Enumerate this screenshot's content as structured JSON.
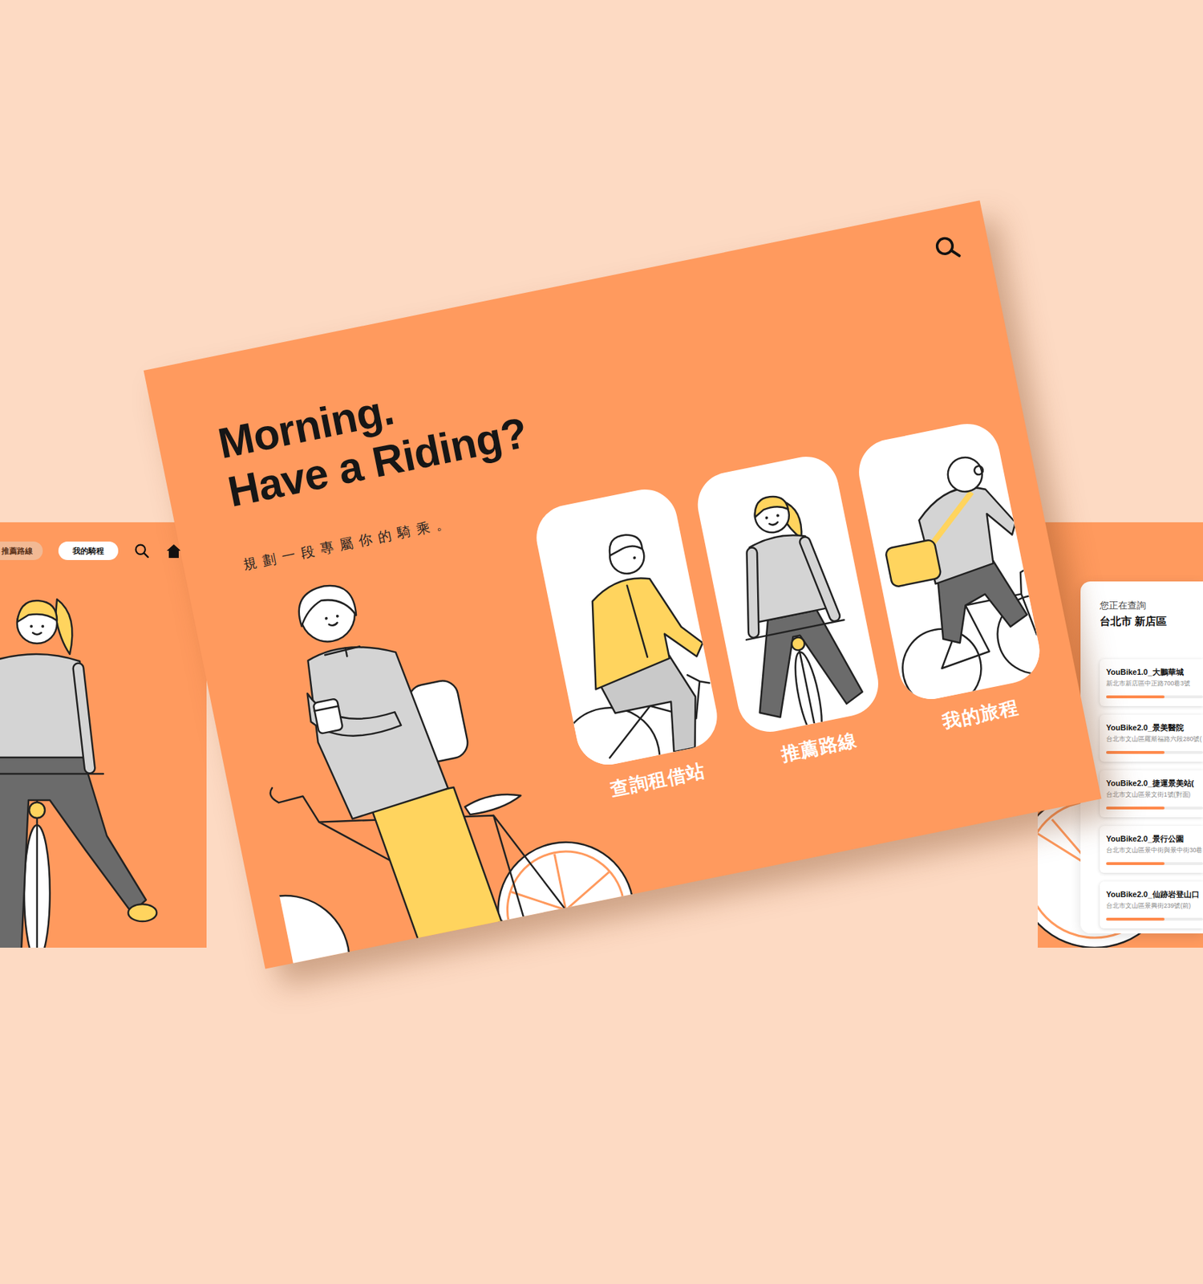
{
  "main": {
    "title_lines": [
      "Morning.",
      "Have a Riding?"
    ],
    "subtitle": "規劃一段專屬你的騎乘。",
    "cards": [
      {
        "label": "查詢租借站"
      },
      {
        "label": "推薦路線"
      },
      {
        "label": "我的旅程"
      }
    ]
  },
  "left_screen": {
    "nav": [
      {
        "label": "推薦路線",
        "selected": false
      },
      {
        "label": "我的騎程",
        "selected": true
      }
    ]
  },
  "right_screen": {
    "query_label": "您正在查詢",
    "query_location": "台北市 新店區",
    "stations": [
      {
        "name": "YouBike1.0_大鵬華城",
        "address": "新北市新店區中正路700巷3號",
        "level": 0.6
      },
      {
        "name": "YouBike2.0_景美醫院",
        "address": "台北市文山區羅斯福路六段280號(",
        "level": 0.6
      },
      {
        "name": "YouBike2.0_捷運景美站(",
        "address": "台北市文山區景文街1號(對面)",
        "level": 0.6
      },
      {
        "name": "YouBike2.0_景行公園",
        "address": "台北市文山區景中街與景中街30巷",
        "level": 0.6
      },
      {
        "name": "YouBike2.0_仙跡岩登山口",
        "address": "台北市文山區景興街239號(前)",
        "level": 0.6
      }
    ]
  }
}
